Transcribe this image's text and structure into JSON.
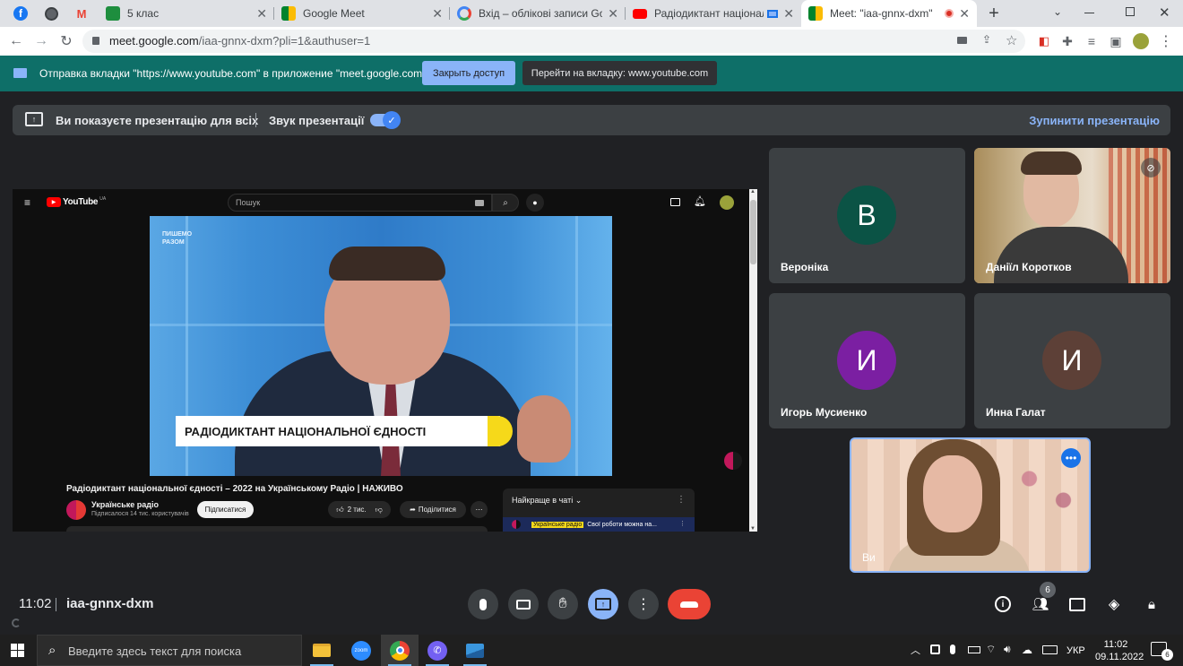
{
  "browser": {
    "tabs": [
      {
        "title": "5 клас"
      },
      {
        "title": "Google Meet"
      },
      {
        "title": "Вхід – облікові записи Google"
      },
      {
        "title": "Радіодиктант національн"
      },
      {
        "title": "Meet: \"iaa-gnnx-dxm\""
      }
    ],
    "address": {
      "host": "meet.google.com",
      "path": "/iaa-gnnx-dxm?pli=1&authuser=1"
    }
  },
  "share_infobar": {
    "message": "Отправка вкладки \"https://www.youtube.com\" в приложение \"meet.google.com\"...",
    "stop_button": "Закрыть доступ",
    "goto_button": "Перейти на вкладку: www.youtube.com"
  },
  "presenting_bar": {
    "message": "Ви показуєте презентацію для всіх",
    "sound_label": "Звук презентації",
    "sound_on": true,
    "stop_label": "Зупинити презентацію"
  },
  "youtube": {
    "logo": "YouTube",
    "region": "UA",
    "search_placeholder": "Пошук",
    "video_brand": "ПИШЕМО РАЗОМ",
    "banner_text": "РАДІОДИКТАНТ НАЦІОНАЛЬНОЇ ЄДНОСТІ",
    "video_title": "Радіодиктант національної єдності – 2022 на Українському Радіо | НАЖИВО",
    "channel": "Українське радіо",
    "subscribers": "Підписалося 14 тис. користувачів",
    "subscribe_label": "Підписатися",
    "likes": "2 тис.",
    "share_label": "Поділитися",
    "chat_header": "Найкраще в чаті",
    "chat_badge": "Українське радіо",
    "chat_message": "Свої роботи можна на..."
  },
  "participants": [
    {
      "name": "Вероніка",
      "initial": "В",
      "color": "#0b5345"
    },
    {
      "name": "Даніїл Коротков",
      "muted": true
    },
    {
      "name": "Игорь Мусиенко",
      "initial": "И",
      "color": "#7b1fa2"
    },
    {
      "name": "Инна Галат",
      "initial": "И",
      "color": "#5d4037"
    },
    {
      "name": "Ви"
    }
  ],
  "meeting": {
    "time": "11:02",
    "code": "iaa-gnnx-dxm",
    "people_count": "6"
  },
  "taskbar": {
    "search_placeholder": "Введите здесь текст для поиска",
    "lang": "УКР",
    "time": "11:02",
    "date": "09.11.2022",
    "notifications": "6"
  }
}
